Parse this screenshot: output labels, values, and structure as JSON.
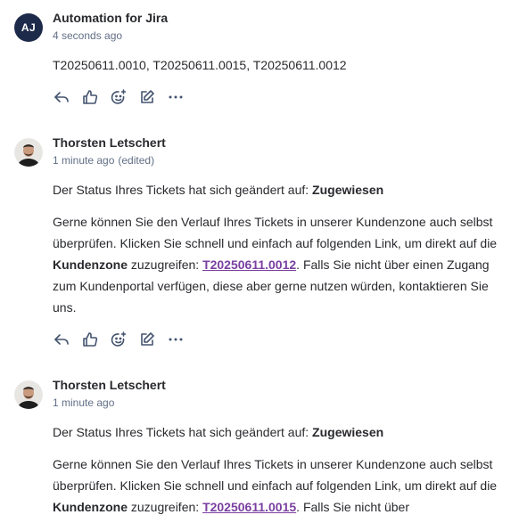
{
  "comments": [
    {
      "author": "Automation for Jira",
      "avatar_initials": "AJ",
      "time": "4 seconds ago",
      "edited": "",
      "body": [
        "T20250611.0010, T20250611.0015, T20250611.0012"
      ],
      "actions": [
        "reply-icon",
        "like-icon",
        "add-reaction-icon",
        "edit-icon",
        "more-icon"
      ]
    },
    {
      "author": "Thorsten Letschert",
      "time": "1 minute ago",
      "edited": "(edited)",
      "status_prefix": "Der Status Ihres Tickets hat sich geändert auf: ",
      "status_value": "Zugewiesen",
      "para2_a": "Gerne können Sie den Verlauf Ihres Tickets in unserer Kundenzone auch selbst überprüfen. Klicken Sie schnell und einfach auf folgenden Link, um direkt auf die ",
      "para2_bold": "Kundenzone",
      "para2_b": " zuzugreifen: ",
      "para2_link": "T20250611.0012",
      "para2_c": ". Falls Sie nicht über einen Zugang zum Kundenportal verfügen, diese aber gerne nutzen würden, kontaktieren Sie uns.",
      "actions": [
        "reply-icon",
        "like-icon",
        "add-reaction-icon",
        "edit-icon",
        "more-icon"
      ]
    },
    {
      "author": "Thorsten Letschert",
      "time": "1 minute ago",
      "status_prefix": "Der Status Ihres Tickets hat sich geändert auf: ",
      "status_value": "Zugewiesen",
      "para2_a": "Gerne können Sie den Verlauf Ihres Tickets in unserer Kundenzone auch selbst überprüfen. Klicken Sie schnell und einfach auf folgenden Link, um direkt auf die ",
      "para2_bold": "Kundenzone",
      "para2_b": " zuzugreifen: ",
      "para2_link": "T20250611.0015",
      "para2_c": ". Falls Sie nicht über"
    }
  ]
}
